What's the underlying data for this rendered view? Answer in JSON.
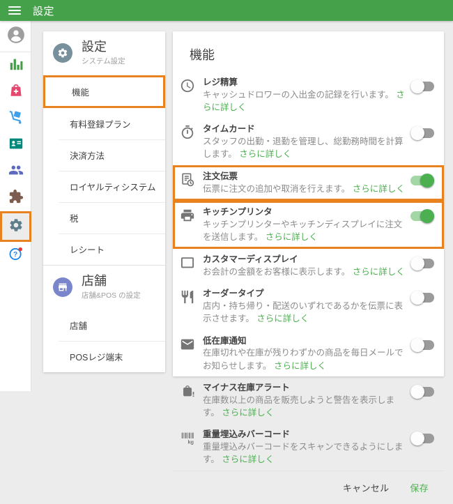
{
  "app": {
    "title": "設定"
  },
  "colors": {
    "header_green": "#46a24a",
    "accent_green": "#4caf50",
    "highlight_orange": "#e8821e",
    "toggle_on_track": "#a3d7a5",
    "badge_red": "#e53935"
  },
  "sidebar": {
    "items": [
      {
        "id": "account",
        "icon": "avatar-icon",
        "color": "#9e9e9e",
        "active": false,
        "badge": false
      },
      {
        "id": "reports",
        "icon": "bar-chart-icon",
        "color": "#43a047",
        "active": false,
        "badge": false
      },
      {
        "id": "items",
        "icon": "items-basket-icon",
        "color": "#e5476f",
        "active": false,
        "badge": false
      },
      {
        "id": "inventory",
        "icon": "hand-truck-icon",
        "color": "#41a0ea",
        "active": false,
        "badge": false
      },
      {
        "id": "employees",
        "icon": "id-card-icon",
        "color": "#00897b",
        "active": false,
        "badge": false
      },
      {
        "id": "customers",
        "icon": "customers-icon",
        "color": "#5c6bc0",
        "active": false,
        "badge": false
      },
      {
        "id": "apps",
        "icon": "puzzle-icon",
        "color": "#7d5c50",
        "active": false,
        "badge": false
      },
      {
        "id": "settings",
        "icon": "gear-icon",
        "color": "#607d8b",
        "active": true,
        "badge": false
      },
      {
        "id": "help",
        "icon": "help-icon",
        "color": "#1e88e5",
        "active": false,
        "badge": true
      }
    ]
  },
  "settings_panel": {
    "header": {
      "icon": "gear-circle-icon",
      "icon_bg": "#78909c",
      "title": "設定",
      "subtitle": "システム設定"
    },
    "menu": [
      {
        "label": "機能",
        "active": true
      },
      {
        "label": "有料登録プラン",
        "active": false
      },
      {
        "label": "決済方法",
        "active": false
      },
      {
        "label": "ロイヤルティシステム",
        "active": false
      },
      {
        "label": "税",
        "active": false
      },
      {
        "label": "レシート",
        "active": false
      }
    ],
    "store_section": {
      "header": {
        "icon": "store-circle-icon",
        "icon_bg": "#7986cb",
        "title": "店舗",
        "subtitle": "店舗&POS の設定"
      },
      "menu": [
        {
          "label": "店舗",
          "active": false
        },
        {
          "label": "POSレジ端末",
          "active": false
        }
      ]
    }
  },
  "features_panel": {
    "title": "機能",
    "rows": [
      {
        "icon": "clock-icon",
        "title": "レジ精算",
        "desc": "キャッシュドロワーの入出金の記録を行います。",
        "link": "さらに詳しく",
        "enabled": false,
        "highlighted": false
      },
      {
        "icon": "stopwatch-icon",
        "title": "タイムカード",
        "desc": "スタッフの出勤・退勤を管理し、総勤務時間を計算します。",
        "link": "さらに詳しく",
        "enabled": false,
        "highlighted": false
      },
      {
        "icon": "ticket-clock-icon",
        "title": "注文伝票",
        "desc": "伝票に注文の追加や取消を行えます。",
        "link": "さらに詳しく",
        "enabled": true,
        "highlighted": true
      },
      {
        "icon": "printer-icon",
        "title": "キッチンプリンタ",
        "desc": "キッチンプリンターやキッチンディスプレイに注文を送信します。",
        "link": "さらに詳しく",
        "enabled": true,
        "highlighted": true
      },
      {
        "icon": "display-icon",
        "title": "カスタマーディスプレイ",
        "desc": "お会計の金額をお客様に表示します。",
        "link": "さらに詳しく",
        "enabled": false,
        "highlighted": false
      },
      {
        "icon": "utensils-icon",
        "title": "オーダータイプ",
        "desc": "店内・持ち帰り・配送のいずれであるかを伝票に表示させます。",
        "link": "さらに詳しく",
        "enabled": false,
        "highlighted": false
      },
      {
        "icon": "envelope-icon",
        "title": "低在庫通知",
        "desc": "在庫切れや在庫が残りわずかの商品を毎日メールでお知らせします。",
        "link": "さらに詳しく",
        "enabled": false,
        "highlighted": false
      },
      {
        "icon": "bag-alert-icon",
        "title": "マイナス在庫アラート",
        "desc": "在庫数以上の商品を販売しようと警告を表示します。",
        "link": "さらに詳しく",
        "enabled": false,
        "highlighted": false
      },
      {
        "icon": "barcode-kg-icon",
        "title": "重量埋込みバーコード",
        "desc": "重量埋込みバーコードをスキャンできるようにします。",
        "link": "さらに詳しく",
        "enabled": false,
        "highlighted": false
      }
    ],
    "footer": {
      "cancel": "キャンセル",
      "save": "保存"
    }
  }
}
